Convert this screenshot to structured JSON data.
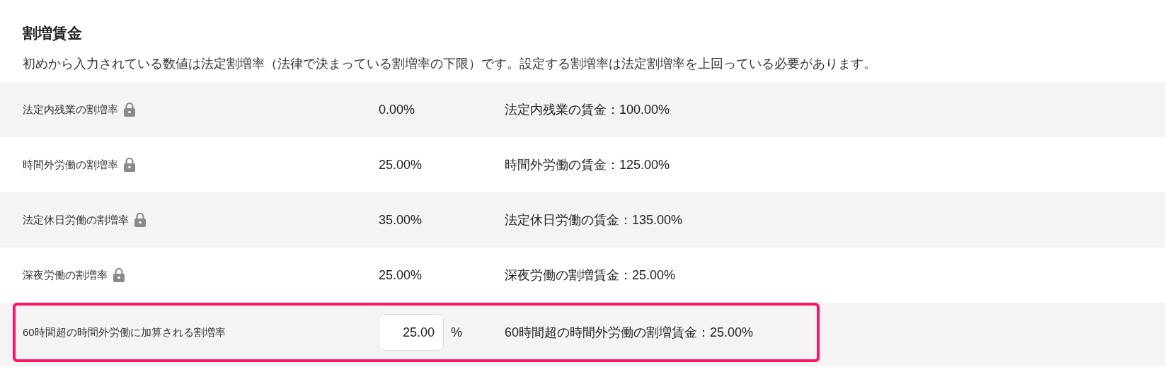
{
  "section": {
    "title": "割増賃金",
    "description": "初めから入力されている数値は法定割増率（法律で決まっている割増率の下限）です。設定する割増率は法定割増率を上回っている必要があります。"
  },
  "rows": [
    {
      "kind": "locked",
      "label": "法定内残業の割増率",
      "value": "0.00%",
      "wage": "法定内残業の賃金：100.00%",
      "highlighted": false
    },
    {
      "kind": "locked",
      "label": "時間外労働の割増率",
      "value": "25.00%",
      "wage": "時間外労働の賃金：125.00%",
      "highlighted": false
    },
    {
      "kind": "locked",
      "label": "法定休日労働の割増率",
      "value": "35.00%",
      "wage": "法定休日労働の賃金：135.00%",
      "highlighted": false
    },
    {
      "kind": "locked",
      "label": "深夜労働の割増率",
      "value": "25.00%",
      "wage": "深夜労働の割増賃金：25.00%",
      "highlighted": false
    },
    {
      "kind": "input",
      "label": "60時間超の時間外労働に加算される割増率",
      "value": "25.00",
      "unit": "%",
      "wage": "60時間超の時間外労働の割増賃金：25.00%",
      "highlighted": true
    }
  ]
}
